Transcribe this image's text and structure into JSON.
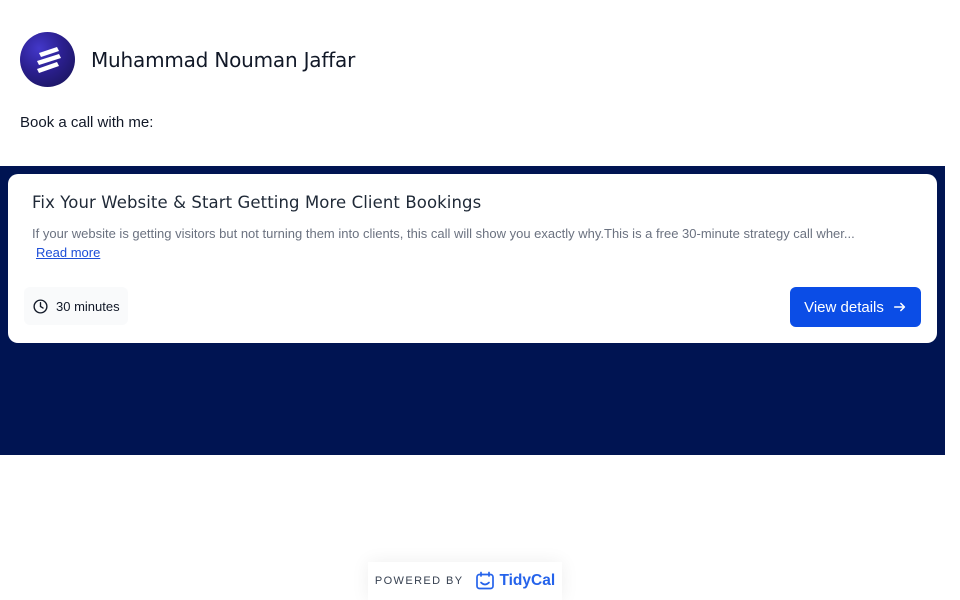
{
  "profile": {
    "name": "Muhammad Nouman Jaffar",
    "avatar_icon": "striped-logo-icon"
  },
  "intro_text": "Book a call with me:",
  "colors": {
    "band": "#001452",
    "primary_button": "#0b4de6",
    "link": "#1d4ed8",
    "brand_tidycal": "#2563eb"
  },
  "event": {
    "title": "Fix Your Website & Start Getting More Client Bookings",
    "description": "If your website is getting visitors but not turning them into clients, this call will show you exactly why.This is a free 30-minute strategy call wher...",
    "read_more_label": "Read more",
    "duration": "30 minutes",
    "duration_icon": "clock-icon",
    "view_details_label": "View details",
    "view_details_icon": "arrow-right-icon"
  },
  "footer": {
    "powered_label": "POWERED BY",
    "brand_name": "TidyCal",
    "brand_icon": "tidycal-logo-icon"
  }
}
